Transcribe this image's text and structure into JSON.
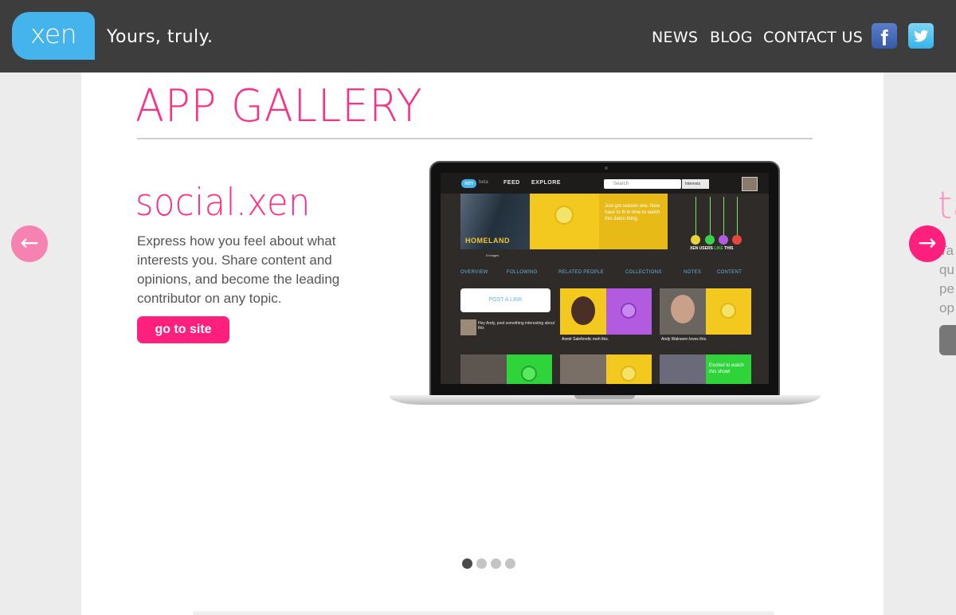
{
  "header": {
    "logo_text": "xen",
    "tagline": "Yours, truly.",
    "nav": [
      "NEWS",
      "BLOG",
      "CONTACT US"
    ],
    "social": [
      {
        "name": "facebook",
        "glyph": "f"
      },
      {
        "name": "twitter",
        "glyph": "t"
      }
    ]
  },
  "gallery": {
    "title": "APP GALLERY",
    "slide": {
      "app_name": "social.xen",
      "description": "Express how you feel about what interests you. Share content and opinions, and become the leading contributor on any topic.",
      "button_label": "go to site"
    },
    "next_slide_peek": {
      "title_fragment": "ta",
      "lines": [
        "Ta",
        "qu",
        "pe",
        "op"
      ]
    },
    "pagination": {
      "count": 4,
      "active_index": 0
    }
  },
  "arrows": {
    "prev_glyph": "←",
    "next_glyph": "→"
  },
  "screen": {
    "logo": "xen",
    "beta": "beta",
    "nav": [
      "FEED",
      "EXPLORE"
    ],
    "search_placeholder": "Search",
    "interests_label": "Interests",
    "show_title": "HOMELAND",
    "images_count": "5 images",
    "bubble_text": "Just got season one. Now have to fit in time to watch this damn thing.",
    "users_like_prefix": "XEN USERS ",
    "users_like_word": "LIKE",
    "users_like_suffix": " THIS",
    "tabs": [
      "OVERVIEW",
      "FOLLOWING",
      "RELATED PEOPLE",
      "COLLECTIONS",
      "NOTES",
      "CONTENT"
    ],
    "post_link": "POST A LINK",
    "comment": "Hey Andy, post something interesting about this",
    "captions": [
      "Asmir Salefendic meh this.",
      "Andy Walraven loves this."
    ],
    "tile_text": "Excited to watch this show!"
  },
  "colors": {
    "accent_pink": "#ff1f7d",
    "title_pink": "#ff2e84",
    "logo_blue": "#45b4ec",
    "header_bg": "#3d3d3d"
  }
}
